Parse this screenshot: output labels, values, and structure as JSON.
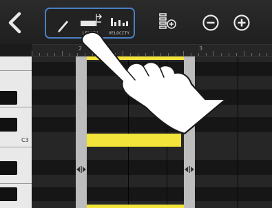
{
  "toolbar": {
    "back_icon": "chevron-left-icon",
    "tools": [
      {
        "name": "pencil",
        "icon": "pencil-icon",
        "label": ""
      },
      {
        "name": "length",
        "icon": "length-icon",
        "label": "LENGTH"
      },
      {
        "name": "velocity",
        "icon": "velocity-icon",
        "label": "VELOCITY"
      }
    ],
    "quantize_icon": "quantize-icon",
    "zoom_out_icon": "zoom-out-icon",
    "zoom_in_icon": "zoom-in-icon",
    "highlight_color": "#4a7fc4"
  },
  "ruler": {
    "bar_numbers": [
      "2",
      "3"
    ]
  },
  "keyboard": {
    "note_label": "C3"
  },
  "piano_roll": {
    "note_color": "#f2e43a",
    "selection_color": "#bdbdbd",
    "handle_icon": "resize-handle-icon"
  },
  "overlay": {
    "gesture_icon": "pointing-hand-icon"
  }
}
